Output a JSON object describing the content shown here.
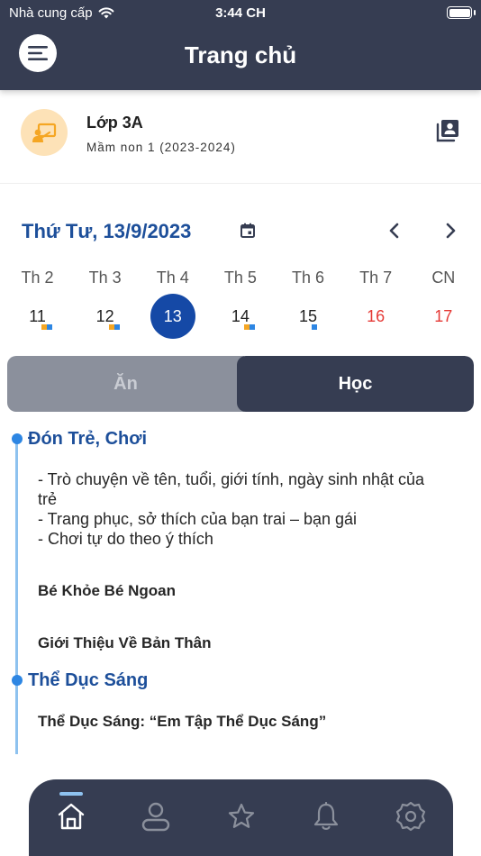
{
  "status_bar": {
    "carrier": "Nhà cung cấp",
    "time": "3:44 CH"
  },
  "header": {
    "title": "Trang chủ"
  },
  "class_info": {
    "name": "Lớp 3A",
    "subtitle": "Mầm non 1 (2023-2024)"
  },
  "calendar": {
    "date_title": "Thứ Tư, 13/9/2023",
    "days": [
      {
        "label": "Th 2",
        "num": "11"
      },
      {
        "label": "Th 3",
        "num": "12"
      },
      {
        "label": "Th 4",
        "num": "13"
      },
      {
        "label": "Th 5",
        "num": "14"
      },
      {
        "label": "Th 6",
        "num": "15"
      },
      {
        "label": "Th 7",
        "num": "16"
      },
      {
        "label": "CN",
        "num": "17"
      }
    ]
  },
  "tabs": {
    "eat": "Ăn",
    "study": "Học"
  },
  "schedule": {
    "section1": {
      "title": "Đón Trẻ, Chơi",
      "lines": [
        "- Trò chuyện về tên, tuổi, giới tính, ngày sinh nhật của",
        "trẻ",
        "- Trang phục, sở thích của bạn trai – bạn gái",
        "- Chơi tự do theo ý thích"
      ],
      "item1": "Bé Khỏe Bé Ngoan",
      "item2": "Giới Thiệu Về Bản Thân"
    },
    "section2": {
      "title": "Thể Dục Sáng",
      "item1": "Thể Dục Sáng: “Em Tập Thể Dục Sáng”"
    }
  },
  "colors": {
    "header_bg": "#363d52",
    "accent_blue": "#1d4f9a",
    "selected_day": "#1549a6",
    "weekend_red": "#e53935",
    "dot_orange": "#f5a623",
    "dot_blue": "#2d86e3"
  }
}
